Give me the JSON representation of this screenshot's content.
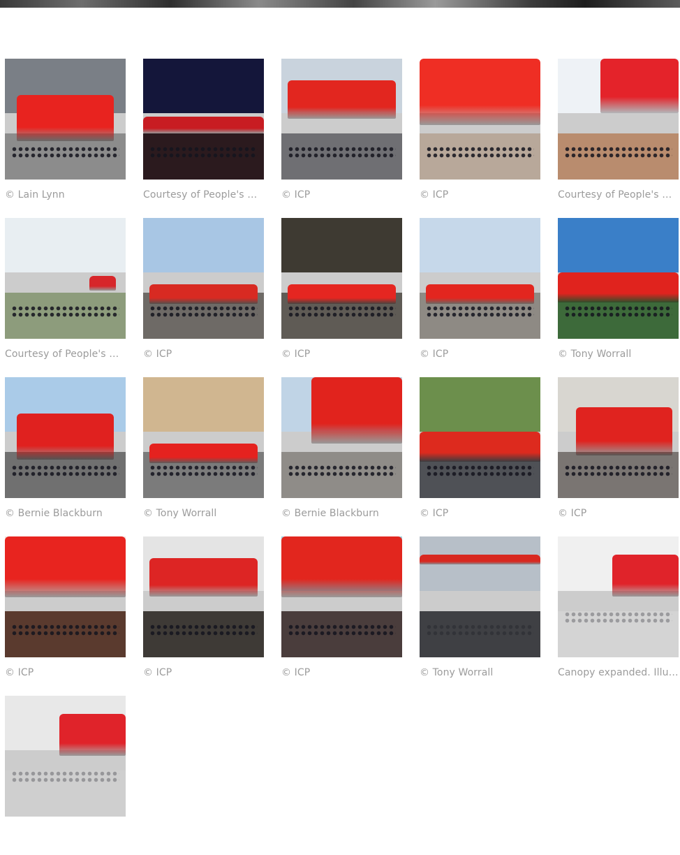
{
  "gallery": {
    "items": [
      {
        "caption": "© Lain Lynn",
        "sky": "#7a7f86",
        "ground": "#8c8c8c",
        "canopy": "#e8231f",
        "scene": "street"
      },
      {
        "caption": "Courtesy of People's Canopy",
        "sky": "#14163a",
        "ground": "#2b1a1e",
        "canopy": "#c81c22",
        "scene": "night"
      },
      {
        "caption": "© ICP",
        "sky": "#c9d3dd",
        "ground": "#6f6f73",
        "canopy": "#e2261f",
        "scene": "crowd"
      },
      {
        "caption": "© ICP",
        "sky": "#ffffff",
        "ground": "#b8a89a",
        "canopy": "#ef2e24",
        "scene": "closeup"
      },
      {
        "caption": "Courtesy of People's Canopy",
        "sky": "#eef2f6",
        "ground": "#b98c6e",
        "canopy": "#e4232a",
        "scene": "plaza"
      },
      {
        "caption": "Courtesy of People's Canopy",
        "sky": "#e8eef2",
        "ground": "#8d9c7c",
        "canopy": "#d7262a",
        "scene": "park"
      },
      {
        "caption": "© ICP",
        "sky": "#a8c6e4",
        "ground": "#6e6a66",
        "canopy": "#d82a22",
        "scene": "building"
      },
      {
        "caption": "© ICP",
        "sky": "#3e3a32",
        "ground": "#5f5b55",
        "canopy": "#e52621",
        "scene": "market"
      },
      {
        "caption": "© ICP",
        "sky": "#c6d8ea",
        "ground": "#8e8a84",
        "canopy": "#e3261f",
        "scene": "building"
      },
      {
        "caption": "© Tony Worrall",
        "sky": "#3a7fc8",
        "ground": "#3d6a3a",
        "canopy": "#e0231e",
        "scene": "trees"
      },
      {
        "caption": "© Bernie Blackburn",
        "sky": "#aacbe8",
        "ground": "#707070",
        "canopy": "#e0211f",
        "scene": "street"
      },
      {
        "caption": "© Tony Worrall",
        "sky": "#d0b690",
        "ground": "#7b7b7b",
        "canopy": "#e5221f",
        "scene": "building"
      },
      {
        "caption": "© Bernie Blackburn",
        "sky": "#c0d4e6",
        "ground": "#8f8c88",
        "canopy": "#e1231d",
        "scene": "arch"
      },
      {
        "caption": "© ICP",
        "sky": "#6c8f4c",
        "ground": "#4f5156",
        "canopy": "#dd2a1e",
        "scene": "trees"
      },
      {
        "caption": "© ICP",
        "sky": "#d8d6d0",
        "ground": "#7a7572",
        "canopy": "#e0231f",
        "scene": "festival"
      },
      {
        "caption": "© ICP",
        "sky": "#f1e4e0",
        "ground": "#5a3a2e",
        "canopy": "#e8241f",
        "scene": "inside"
      },
      {
        "caption": "© ICP",
        "sky": "#e4e4e4",
        "ground": "#3e3a36",
        "canopy": "#dd2524",
        "scene": "crowd"
      },
      {
        "caption": "© ICP",
        "sky": "#9fd2e0",
        "ground": "#4a3d3c",
        "canopy": "#e2261e",
        "scene": "inside"
      },
      {
        "caption": "© Tony Worrall",
        "sky": "#b7bfc8",
        "ground": "#3f4044",
        "canopy": "#d82820",
        "scene": "bikes"
      },
      {
        "caption": "Canopy expanded. Illustration",
        "sky": "#f0f0f0",
        "ground": "#d4d4d4",
        "canopy": "#e0232a",
        "scene": "render"
      },
      {
        "caption": "",
        "sky": "#e8e8e8",
        "ground": "#cfcfcf",
        "canopy": "#e0232a",
        "scene": "render"
      }
    ]
  }
}
